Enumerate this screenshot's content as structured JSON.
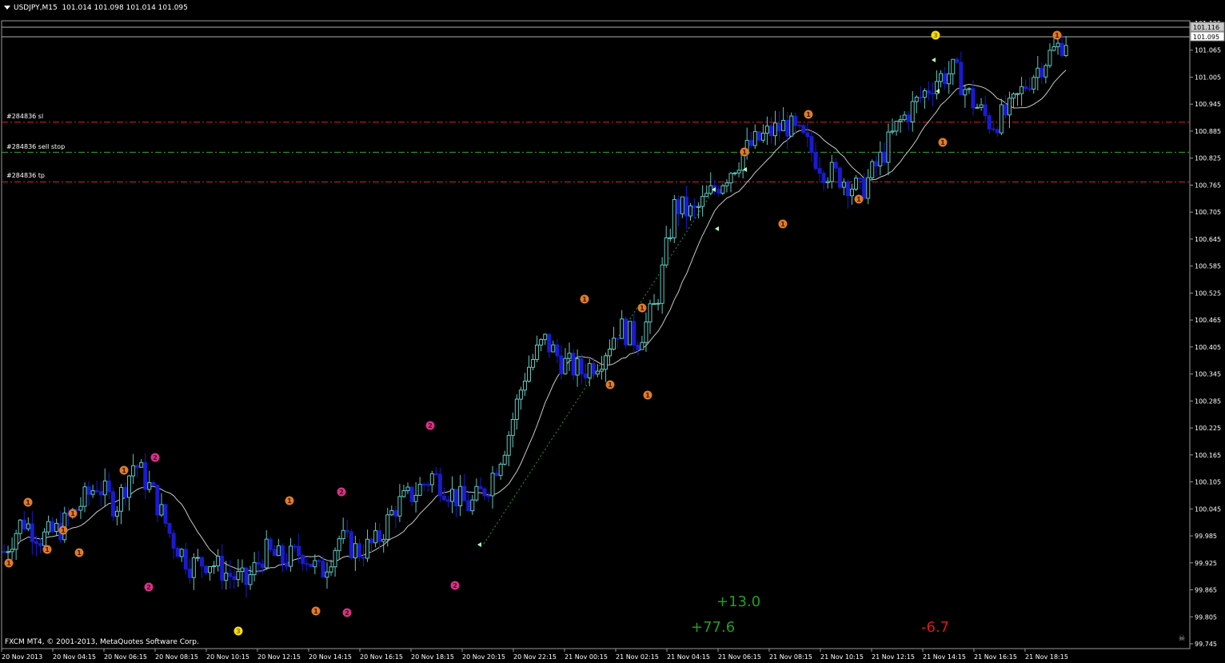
{
  "header": {
    "symbol": "USDJPY,M15",
    "ohlc": "101.014 101.098 101.014 101.095"
  },
  "price_axis": {
    "ticks": [
      "101.125",
      "101.065",
      "101.005",
      "100.945",
      "100.885",
      "100.825",
      "100.765",
      "100.705",
      "100.645",
      "100.585",
      "100.525",
      "100.465",
      "100.405",
      "100.345",
      "100.285",
      "100.225",
      "100.165",
      "100.105",
      "100.045",
      "99.985",
      "99.925",
      "99.865",
      "99.805",
      "99.745"
    ],
    "ask_label": "101.116",
    "bid_label": "101.095"
  },
  "time_axis": {
    "labels": [
      "20 Nov 2013",
      "20 Nov 04:15",
      "20 Nov 06:15",
      "20 Nov 08:15",
      "20 Nov 10:15",
      "20 Nov 12:15",
      "20 Nov 14:15",
      "20 Nov 16:15",
      "20 Nov 18:15",
      "20 Nov 20:15",
      "20 Nov 22:15",
      "21 Nov 00:15",
      "21 Nov 02:15",
      "21 Nov 04:15",
      "21 Nov 06:15",
      "21 Nov 08:15",
      "21 Nov 10:15",
      "21 Nov 12:15",
      "21 Nov 14:15",
      "21 Nov 16:15",
      "21 Nov 18:15"
    ]
  },
  "order_lines": [
    {
      "label": "#284836 sl",
      "price": 100.905,
      "color": "#e02020"
    },
    {
      "label": "#284836 sell stop",
      "price": 100.838,
      "color": "#3aa53a"
    },
    {
      "label": "#284836 tp",
      "price": 100.772,
      "color": "#e02020"
    }
  ],
  "profit_labels": [
    {
      "text": "+13.0",
      "color": "#1fa01f"
    },
    {
      "text": "+77.6",
      "color": "#1fa01f"
    },
    {
      "text": "-6.7",
      "color": "#e01515"
    }
  ],
  "copyright": "FXCM MT4, © 2001-2013, MetaQuotes Software Corp.",
  "colors": {
    "bull": "#5fc9c0",
    "bear": "#1a1ad0",
    "ma": "#c8c8c8",
    "orange": "#e07a2a",
    "magenta": "#d8308a",
    "yellow": "#f0e010"
  },
  "chart_data": {
    "type": "candlestick",
    "symbol": "USDJPY",
    "timeframe": "M15",
    "ylim": [
      99.745,
      101.125
    ],
    "close_path": [
      99.95,
      100.02,
      99.98,
      100.0,
      100.05,
      100.1,
      100.05,
      100.15,
      100.08,
      99.98,
      99.92,
      99.93,
      99.9,
      99.88,
      99.95,
      99.93,
      99.95,
      99.9,
      99.98,
      99.95,
      99.97,
      100.05,
      100.08,
      100.12,
      100.08,
      100.05,
      100.1,
      100.2,
      100.35,
      100.42,
      100.37,
      100.35,
      100.38,
      100.45,
      100.42,
      100.5,
      100.72,
      100.7,
      100.75,
      100.8,
      100.85,
      100.88,
      100.9,
      100.86,
      100.8,
      100.78,
      100.75,
      100.82,
      100.9,
      100.95,
      101.0,
      101.02,
      100.95,
      100.9,
      100.93,
      101.0,
      101.05,
      101.09
    ],
    "markers": [
      {
        "label": "1",
        "price": 100.05,
        "color": "orange"
      },
      {
        "label": "2",
        "price": 100.15,
        "color": "magenta"
      },
      {
        "label": "3",
        "price": 99.8,
        "color": "yellow"
      },
      {
        "label": "3",
        "price": 101.11,
        "color": "yellow"
      }
    ]
  }
}
